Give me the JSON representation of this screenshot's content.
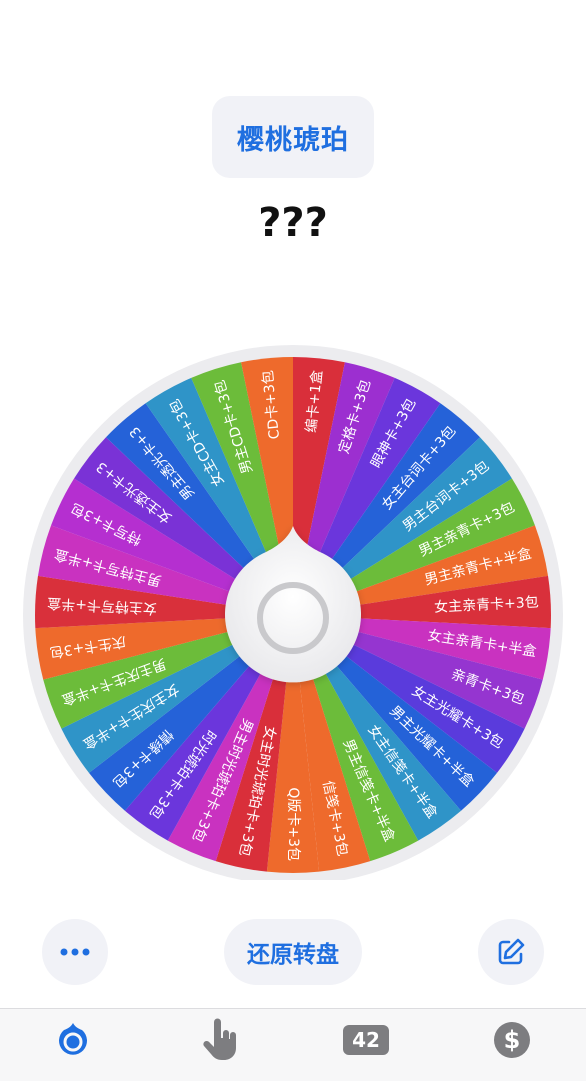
{
  "header": {
    "wheel_name": "樱桃琥珀",
    "result_text": "???"
  },
  "wheel": {
    "segments": [
      {
        "label": "编卡+1盒",
        "color": "#d92f3a"
      },
      {
        "label": "定格卡+3包",
        "color": "#9c2fd0"
      },
      {
        "label": "眼神卡+3包",
        "color": "#6b36dc"
      },
      {
        "label": "女主台词卡+3包",
        "color": "#2562d8"
      },
      {
        "label": "男主台词卡+3包",
        "color": "#2f94c8"
      },
      {
        "label": "男主亲青卡+3包",
        "color": "#6cbc3a"
      },
      {
        "label": "男主亲青卡+半盒",
        "color": "#ee6a2c"
      },
      {
        "label": "女主亲青卡+3包",
        "color": "#d9303b"
      },
      {
        "label": "女主亲青卡+半盒",
        "color": "#c932c0"
      },
      {
        "label": "亲青卡+3包",
        "color": "#9535d0"
      },
      {
        "label": "女主光耀卡+3包",
        "color": "#5a3bdc"
      },
      {
        "label": "男主光耀卡+半盒",
        "color": "#2462d8"
      },
      {
        "label": "女主信笺卡+半盒",
        "color": "#2f94c8"
      },
      {
        "label": "男主信笺卡+半盒",
        "color": "#6cbc3a"
      },
      {
        "label": "信笺卡+3包",
        "color": "#ee6a2c"
      },
      {
        "label": "Q版卡+3包",
        "color": "#ee6a2c"
      },
      {
        "label": "女主时光琥珀卡+3包",
        "color": "#d92f3a"
      },
      {
        "label": "男主时光琥珀卡+3包",
        "color": "#c932c0"
      },
      {
        "label": "时光琥珀卡+3包",
        "color": "#6b36dc"
      },
      {
        "label": "情缘卡+3包",
        "color": "#2562d8"
      },
      {
        "label": "女主庆生卡+半盒",
        "color": "#2f94c8"
      },
      {
        "label": "男主庆生卡+半盒",
        "color": "#6cbc3a"
      },
      {
        "label": "庆生卡+3包",
        "color": "#ee6a2c"
      },
      {
        "label": "女主特写卡+半盒",
        "color": "#d9303b"
      },
      {
        "label": "男主特写卡+半盒",
        "color": "#c932c0"
      },
      {
        "label": "特写卡+3包",
        "color": "#b52fd0"
      },
      {
        "label": "女主透光卡+3",
        "color": "#7a32d6"
      },
      {
        "label": "男主透光卡+3",
        "color": "#2562d8"
      },
      {
        "label": "女主CD卡+3包",
        "color": "#2f94c8"
      },
      {
        "label": "男主CD卡+3包",
        "color": "#6cbc3a"
      },
      {
        "label": "CD卡+3包",
        "color": "#ee6a2c"
      }
    ]
  },
  "actions": {
    "more_icon": "ellipsis-icon",
    "reset_label": "还原转盘",
    "edit_icon": "edit-icon"
  },
  "tabbar": {
    "tabs": [
      {
        "icon": "wheel-icon",
        "active": true
      },
      {
        "icon": "tap-hand-icon"
      },
      {
        "icon": "counter-badge",
        "count": "42"
      },
      {
        "icon": "dollar-icon"
      }
    ]
  },
  "colors": {
    "accent": "#1f6fe0",
    "pill_bg": "#f1f2f7",
    "inactive_icon": "#7d7d80"
  }
}
